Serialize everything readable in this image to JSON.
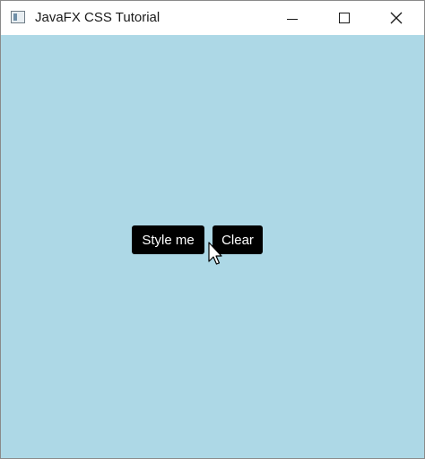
{
  "window": {
    "title": "JavaFX CSS Tutorial",
    "icon": "java-app-icon",
    "controls": [
      "minimize-icon",
      "maximize-icon",
      "close-icon"
    ]
  },
  "content": {
    "background_color": "#add8e6",
    "buttons": [
      {
        "label": "Style me",
        "background": "#000000",
        "text_color": "#ffffff"
      },
      {
        "label": "Clear",
        "background": "#000000",
        "text_color": "#ffffff"
      }
    ]
  },
  "cursor": {
    "icon": "arrow-cursor-icon"
  }
}
